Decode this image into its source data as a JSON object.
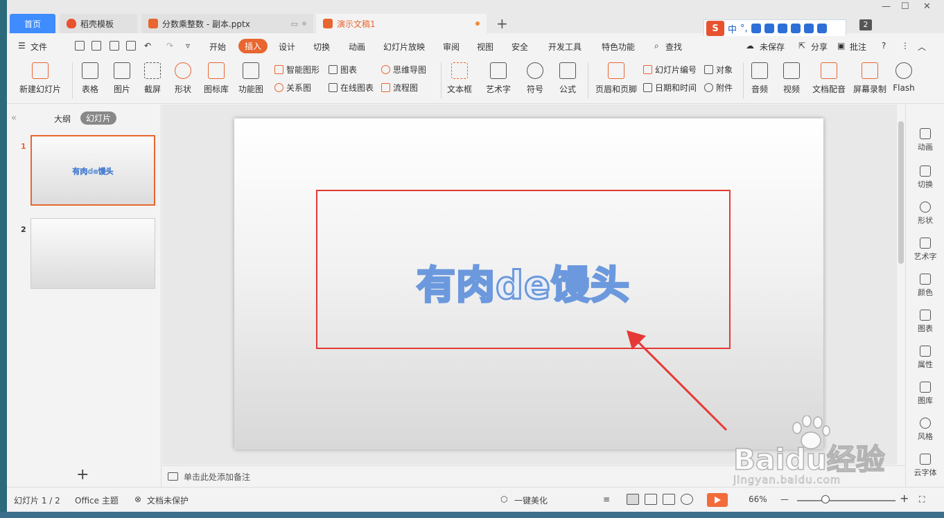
{
  "tabs": {
    "home": "首页",
    "t2": "稻壳模板",
    "t3": "分数乘整数 - 副本.pptx",
    "t4": "演示文稿1",
    "new": "+"
  },
  "ime": {
    "logo": "S",
    "lang": "中",
    "punct": "°,"
  },
  "window_badge": "2",
  "menu": {
    "file": "文件",
    "items": [
      "开始",
      "插入",
      "设计",
      "切换",
      "动画",
      "幻灯片放映",
      "审阅",
      "视图",
      "安全",
      "开发工具",
      "特色功能"
    ],
    "search": "查找",
    "unsaved": "未保存",
    "share": "分享",
    "comment": "批注",
    "help": "?"
  },
  "ribbon": {
    "new_slide": "新建幻灯片",
    "table": "表格",
    "picture": "图片",
    "screenshot": "截屏",
    "shape": "形状",
    "icon_lib": "图标库",
    "func_chart": "功能图",
    "smart_shape": "智能图形",
    "relation": "关系图",
    "chart": "图表",
    "online_chart": "在线图表",
    "mindmap": "思维导图",
    "flowchart": "流程图",
    "textbox": "文本框",
    "wordart": "艺术字",
    "symbol": "符号",
    "formula": "公式",
    "header_footer": "页眉和页脚",
    "slide_number": "幻灯片编号",
    "datetime": "日期和时间",
    "object": "对象",
    "attachment": "附件",
    "audio": "音频",
    "video": "视频",
    "doc_voice": "文档配音",
    "screen_record": "屏幕录制",
    "flash": "Flash"
  },
  "left_panel": {
    "outline": "大纲",
    "slides": "幻灯片",
    "thumbs": [
      {
        "num": "1",
        "title": "有肉de馒头"
      },
      {
        "num": "2",
        "title": ""
      }
    ],
    "add": "+"
  },
  "slide": {
    "title": "有肉de馒头"
  },
  "notes": {
    "placeholder": "单击此处添加备注"
  },
  "right_panel": [
    "动画",
    "切换",
    "形状",
    "艺术字",
    "颜色",
    "图表",
    "属性",
    "图库",
    "风格",
    "云字体"
  ],
  "status": {
    "slide_count": "幻灯片 1 / 2",
    "theme": "Office 主题",
    "protect": "文档未保护",
    "beautify": "一键美化",
    "zoom": "66%",
    "zoom_fraction": 0.29
  },
  "watermark": {
    "brand": "Baidu经验",
    "url": "jingyan.baidu.com"
  },
  "colors": {
    "accent": "#e8662f",
    "home_tab": "#3f8cff",
    "highlight_box": "#e53935"
  }
}
